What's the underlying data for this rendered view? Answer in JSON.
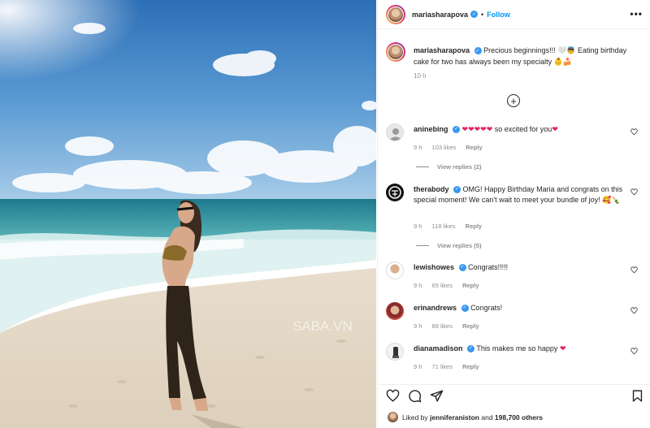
{
  "post": {
    "username": "mariasharapova",
    "follow_label": "Follow",
    "more_label": "•••",
    "dot": "•"
  },
  "caption": {
    "username": "mariasharapova",
    "text": "Precious beginnings!!! 🤍👼 Eating birthday cake for two has always been my specialty 👶🍰",
    "time": "10 h"
  },
  "comments": [
    {
      "username": "aninebing",
      "text": "so excited for you",
      "prefix_emoji": "❤❤❤❤❤",
      "suffix_emoji": "❤",
      "time": "9 h",
      "likes": "103 likes",
      "reply": "Reply",
      "view_replies": "View replies (2)"
    },
    {
      "username": "therabody",
      "text": "OMG! Happy Birthday Maria and congrats on this special moment! We can't wait to meet your bundle of joy! 🥰🍾",
      "time": "9 h",
      "likes": "118 likes",
      "reply": "Reply",
      "view_replies": "View replies (5)"
    },
    {
      "username": "lewishowes",
      "text": "Congrats!!!!!",
      "time": "9 h",
      "likes": "65 likes",
      "reply": "Reply"
    },
    {
      "username": "erinandrews",
      "text": "Congrats!",
      "time": "9 h",
      "likes": "88 likes",
      "reply": "Reply"
    },
    {
      "username": "dianamadison",
      "text": "This makes me so happy",
      "suffix_emoji": "❤",
      "time": "9 h",
      "likes": "71 likes",
      "reply": "Reply"
    }
  ],
  "likes_bar": {
    "liked_by": "Liked by",
    "user": "jenniferaniston",
    "and": "and",
    "others": "198,700 others"
  },
  "watermark": "SABA.VN",
  "colors": {
    "accent": "#0095f6",
    "verified": "#3897f0",
    "heart": "#e0245e",
    "sky": "#3f86c6",
    "sand": "#e6dccd"
  }
}
